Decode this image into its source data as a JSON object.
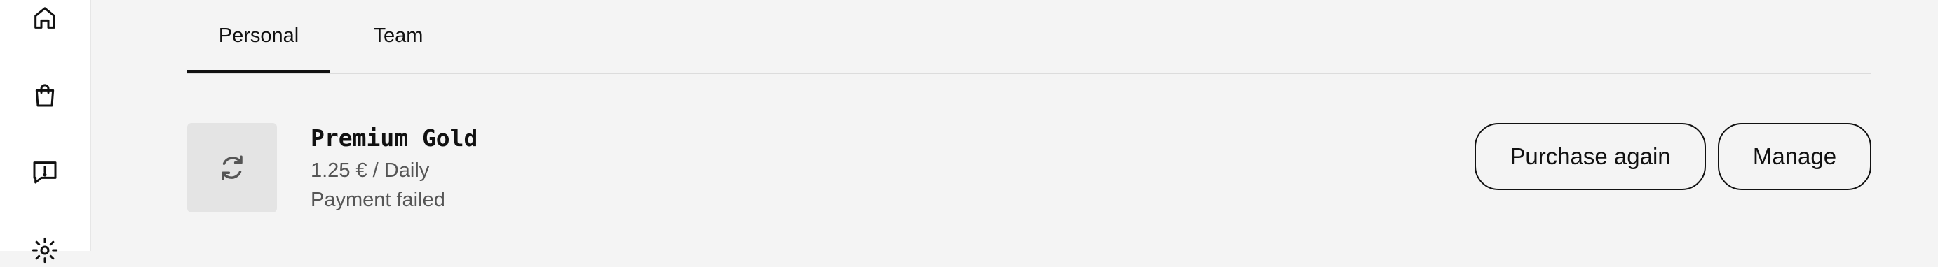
{
  "sidebar": {
    "icons": [
      {
        "icon": "home-icon"
      },
      {
        "icon": "shopping-bag-icon"
      },
      {
        "icon": "message-alert-icon"
      },
      {
        "icon": "settings-icon"
      }
    ]
  },
  "tabs": [
    {
      "label": "Personal",
      "active": true
    },
    {
      "label": "Team",
      "active": false
    }
  ],
  "subscription": {
    "icon": "refresh-icon",
    "title": "Premium Gold",
    "price": "1.25 € / Daily",
    "status": "Payment failed",
    "purchase_again_label": "Purchase again",
    "manage_label": "Manage"
  },
  "colors": {
    "background": "#f4f4f4",
    "sidebar_background": "#ffffff",
    "thumb_background": "#e4e4e4",
    "text_primary": "#111111",
    "text_secondary": "#555555"
  }
}
